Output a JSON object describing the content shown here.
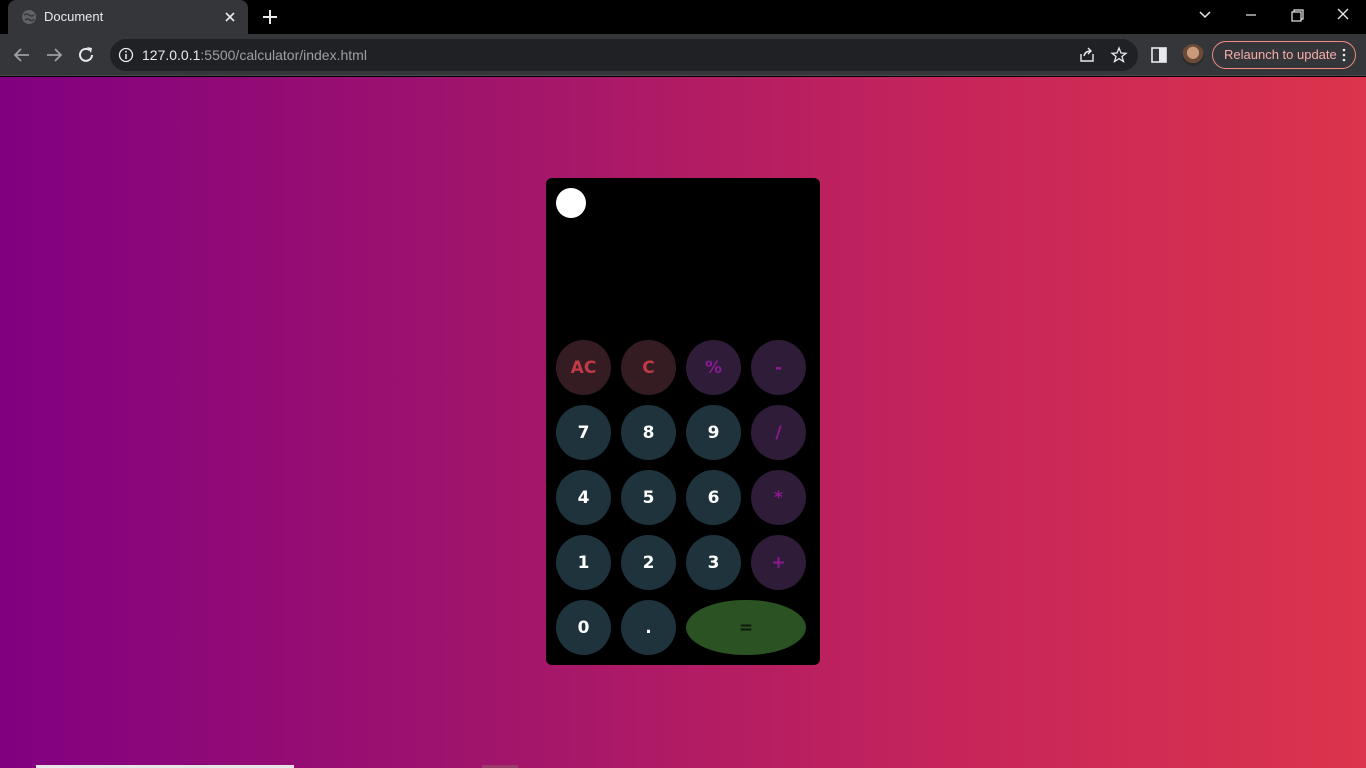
{
  "browser": {
    "tab_title": "Document",
    "url_host": "127.0.0.1",
    "url_rest": ":5500/calculator/index.html",
    "relaunch_label": "Relaunch to update"
  },
  "calculator": {
    "display_value": "",
    "keys": {
      "ac": "AC",
      "c": "C",
      "percent": "%",
      "minus": "-",
      "seven": "7",
      "eight": "8",
      "nine": "9",
      "divide": "/",
      "four": "4",
      "five": "5",
      "six": "6",
      "multiply": "*",
      "one": "1",
      "two": "2",
      "three": "3",
      "plus": "+",
      "zero": "0",
      "dot": ".",
      "equals": "="
    }
  },
  "colors": {
    "gradient_start": "#810080",
    "gradient_end": "#dc344c",
    "number_key": "#1e333c",
    "clear_key": "#341c22",
    "operator_key": "#2e1c38",
    "equals_key": "#2a5222"
  }
}
